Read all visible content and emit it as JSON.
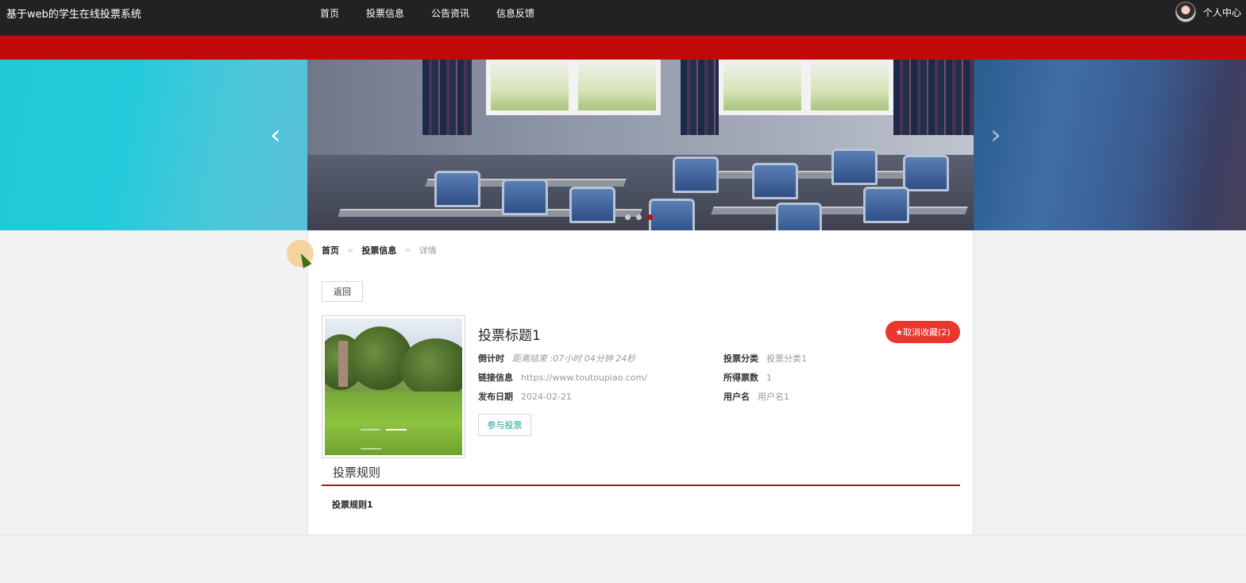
{
  "site": {
    "title": "基于web的学生在线投票系统"
  },
  "nav": {
    "items": [
      "首页",
      "投票信息",
      "公告资讯",
      "信息反馈"
    ]
  },
  "user": {
    "label": "个人中心"
  },
  "carousel": {
    "prev_icon": "‹",
    "next_icon": "›",
    "dots": 3,
    "active_dot": 3
  },
  "breadcrumb": {
    "items": [
      "首页",
      "投票信息"
    ],
    "separator": "=",
    "current": "详情"
  },
  "back_button": "返回",
  "detail": {
    "title": "投票标题1",
    "favorite_button": "★取消收藏(2)",
    "fields": {
      "countdown": {
        "label": "倒计时",
        "value": "距离结束 :07小时 04分钟 24秒"
      },
      "category": {
        "label": "投票分类",
        "value": "投票分类1"
      },
      "link": {
        "label": "链接信息",
        "value": "https://www.toutoupiao.com/"
      },
      "votes": {
        "label": "所得票数",
        "value": "1"
      },
      "date": {
        "label": "发布日期",
        "value": "2024-02-21"
      },
      "username": {
        "label": "用户名",
        "value": "用户名1"
      }
    },
    "join_button": "参与投票"
  },
  "rules": {
    "heading": "投票规则",
    "content": "投票规则1"
  },
  "colors": {
    "topbar": "#222222",
    "accent_red": "#c10a0a",
    "favorite": "#e9372e",
    "join_text": "#1aa194"
  }
}
